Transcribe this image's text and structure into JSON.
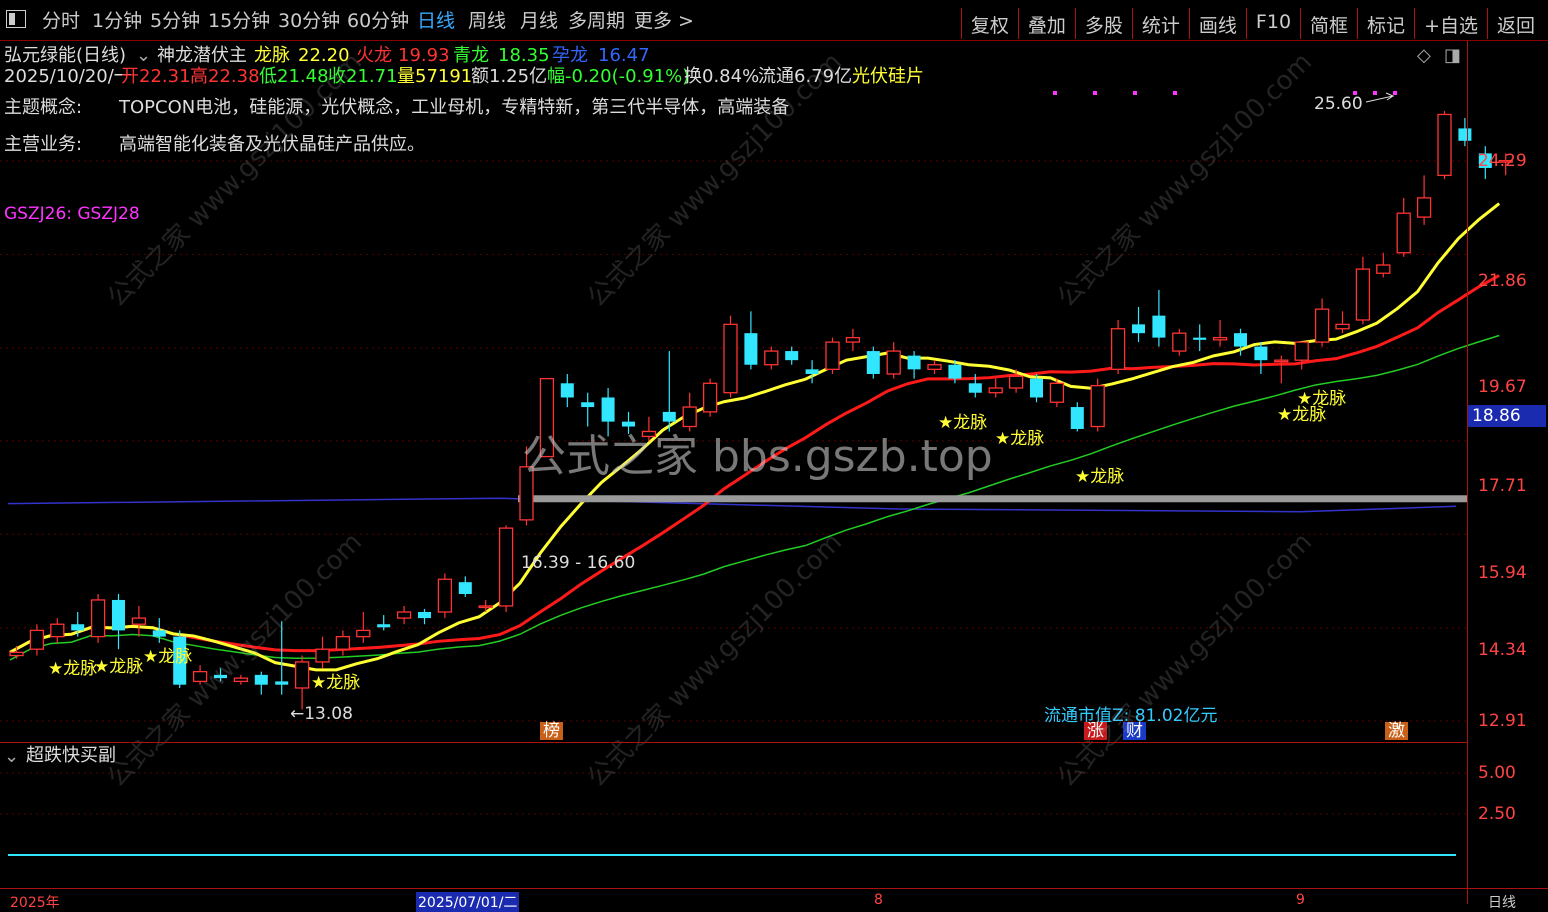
{
  "toolbar": {
    "periods": [
      "分时",
      "1分钟",
      "5分钟",
      "15分钟",
      "30分钟",
      "60分钟",
      "日线",
      "周线",
      "月线",
      "多周期",
      "更多 >"
    ],
    "selected_period": "日线",
    "right_tabs": [
      "复权",
      "叠加",
      "多股",
      "统计",
      "画线",
      "F10",
      "简框",
      "标记",
      "+自选",
      "返回"
    ]
  },
  "header": {
    "stock_name": "弘元绿能(日线)",
    "indicator_name": "神龙潜伏主",
    "longmai_label": "龙脉",
    "longmai_value": "22.20",
    "huolong_label": "火龙",
    "huolong_value": "19.93",
    "qinglong_label": "青龙",
    "qinglong_value": "18.35",
    "yunlong_label": "孕龙",
    "yunlong_value": "16.47"
  },
  "quote": {
    "date": "2025/10/20/一",
    "open": "开22.31",
    "high": "高22.38",
    "low": "低21.48",
    "close": "收21.71",
    "volume": "量57191",
    "amount": "额1.25亿",
    "change": "幅-0.20(-0.91%)",
    "turnover": "换0.84%",
    "float": "流通6.79亿",
    "sector": "光伏硅片"
  },
  "info": {
    "concept_label": "主题概念:",
    "concept_value": "TOPCON电池，硅能源，光伏概念，工业母机，专精特新，第三代半导体，高端装备",
    "business_label": "主营业务:",
    "business_value": "高端智能化装备及光伏晶硅产品供应。"
  },
  "indicator_legend": "GSZJ26: GSZJ28",
  "price_axis": [
    "24.29",
    "21.86",
    "19.67",
    "17.71",
    "15.94",
    "14.34",
    "12.91"
  ],
  "sub_axis": [
    "5.00",
    "2.50"
  ],
  "current_price_tag": "18.86",
  "sub_panel_title": "超跌快买副",
  "annotations": {
    "high_mark": "25.60",
    "low_mark": "←13.08",
    "zone_label": "16.39 - 16.60",
    "float_cap": "流通市值Z: 81.02亿元"
  },
  "signal_label": "★龙脉",
  "event_markers": [
    {
      "text": "榜",
      "color": "#c8601a"
    },
    {
      "text": "涨",
      "color": "#c81a1a"
    },
    {
      "text": "财",
      "color": "#1a3ac8"
    },
    {
      "text": "激",
      "color": "#c8601a"
    }
  ],
  "time_axis": [
    "2025年",
    "2025/07/01/二",
    "8",
    "9"
  ],
  "bottom_right": "日线",
  "watermark": "公式之家 bbs.gszb.top",
  "watermark_small": "公式之家 www.gszj100.com",
  "colors": {
    "up": "#ff3333",
    "down": "#33e6ff",
    "ma_yellow": "#ffff33",
    "ma_red": "#ff1a1a",
    "ma_green": "#22cc22",
    "ma_blue": "#3333cc",
    "axis": "#aa1111"
  },
  "chart_data": {
    "type": "candlestick",
    "y_axis_ticks": [
      24.29,
      21.86,
      19.67,
      17.71,
      15.94,
      14.34,
      12.91
    ],
    "candles": [
      {
        "o": 13.9,
        "c": 13.95,
        "h": 14.05,
        "l": 13.85
      },
      {
        "o": 14.0,
        "c": 14.3,
        "h": 14.4,
        "l": 13.9
      },
      {
        "o": 14.2,
        "c": 14.4,
        "h": 14.5,
        "l": 14.1
      },
      {
        "o": 14.4,
        "c": 14.3,
        "h": 14.6,
        "l": 14.2
      },
      {
        "o": 14.2,
        "c": 14.8,
        "h": 14.9,
        "l": 14.1
      },
      {
        "o": 14.8,
        "c": 14.3,
        "h": 14.9,
        "l": 14.0
      },
      {
        "o": 14.4,
        "c": 14.5,
        "h": 14.7,
        "l": 14.2
      },
      {
        "o": 14.3,
        "c": 14.2,
        "h": 14.5,
        "l": 14.1
      },
      {
        "o": 14.2,
        "c": 13.45,
        "h": 14.3,
        "l": 13.4
      },
      {
        "o": 13.5,
        "c": 13.65,
        "h": 13.75,
        "l": 13.45
      },
      {
        "o": 13.6,
        "c": 13.55,
        "h": 13.7,
        "l": 13.5
      },
      {
        "o": 13.5,
        "c": 13.55,
        "h": 13.6,
        "l": 13.45
      },
      {
        "o": 13.6,
        "c": 13.45,
        "h": 13.65,
        "l": 13.3
      },
      {
        "o": 13.5,
        "c": 13.45,
        "h": 14.45,
        "l": 13.3
      },
      {
        "o": 13.4,
        "c": 13.8,
        "h": 13.9,
        "l": 13.08
      },
      {
        "o": 13.8,
        "c": 14.0,
        "h": 14.2,
        "l": 13.7
      },
      {
        "o": 14.0,
        "c": 14.2,
        "h": 14.3,
        "l": 13.9
      },
      {
        "o": 14.2,
        "c": 14.3,
        "h": 14.6,
        "l": 14.1
      },
      {
        "o": 14.4,
        "c": 14.35,
        "h": 14.55,
        "l": 14.3
      },
      {
        "o": 14.5,
        "c": 14.6,
        "h": 14.7,
        "l": 14.4
      },
      {
        "o": 14.6,
        "c": 14.5,
        "h": 14.65,
        "l": 14.4
      },
      {
        "o": 14.6,
        "c": 15.15,
        "h": 15.25,
        "l": 14.5
      },
      {
        "o": 15.1,
        "c": 14.9,
        "h": 15.2,
        "l": 14.85
      },
      {
        "o": 14.7,
        "c": 14.7,
        "h": 14.8,
        "l": 14.6
      },
      {
        "o": 14.7,
        "c": 16.05,
        "h": 16.1,
        "l": 14.6
      },
      {
        "o": 16.2,
        "c": 17.2,
        "h": 17.6,
        "l": 16.1
      },
      {
        "o": 17.4,
        "c": 19.0,
        "h": 19.0,
        "l": 17.4
      },
      {
        "o": 18.9,
        "c": 18.6,
        "h": 19.1,
        "l": 18.4
      },
      {
        "o": 18.5,
        "c": 18.4,
        "h": 18.7,
        "l": 18.0
      },
      {
        "o": 18.6,
        "c": 18.1,
        "h": 18.8,
        "l": 17.8
      },
      {
        "o": 18.1,
        "c": 18.0,
        "h": 18.3,
        "l": 17.85
      },
      {
        "o": 17.8,
        "c": 17.9,
        "h": 18.2,
        "l": 17.7
      },
      {
        "o": 18.3,
        "c": 18.1,
        "h": 19.6,
        "l": 17.9
      },
      {
        "o": 18.0,
        "c": 18.4,
        "h": 18.7,
        "l": 17.9
      },
      {
        "o": 18.3,
        "c": 18.9,
        "h": 19.0,
        "l": 18.2
      },
      {
        "o": 18.7,
        "c": 20.2,
        "h": 20.4,
        "l": 18.6
      },
      {
        "o": 20.0,
        "c": 19.3,
        "h": 20.5,
        "l": 19.2
      },
      {
        "o": 19.3,
        "c": 19.6,
        "h": 19.7,
        "l": 19.2
      },
      {
        "o": 19.6,
        "c": 19.4,
        "h": 19.7,
        "l": 19.3
      },
      {
        "o": 19.2,
        "c": 19.1,
        "h": 19.4,
        "l": 18.9
      },
      {
        "o": 19.2,
        "c": 19.8,
        "h": 19.9,
        "l": 19.1
      },
      {
        "o": 19.8,
        "c": 19.9,
        "h": 20.1,
        "l": 19.6
      },
      {
        "o": 19.6,
        "c": 19.1,
        "h": 19.7,
        "l": 19.0
      },
      {
        "o": 19.1,
        "c": 19.6,
        "h": 19.8,
        "l": 19.0
      },
      {
        "o": 19.5,
        "c": 19.2,
        "h": 19.6,
        "l": 19.0
      },
      {
        "o": 19.2,
        "c": 19.3,
        "h": 19.4,
        "l": 19.1
      },
      {
        "o": 19.3,
        "c": 19.0,
        "h": 19.4,
        "l": 18.9
      },
      {
        "o": 18.9,
        "c": 18.7,
        "h": 19.1,
        "l": 18.6
      },
      {
        "o": 18.7,
        "c": 18.8,
        "h": 19.0,
        "l": 18.6
      },
      {
        "o": 18.8,
        "c": 19.05,
        "h": 19.2,
        "l": 18.7
      },
      {
        "o": 19.0,
        "c": 18.6,
        "h": 19.1,
        "l": 18.5
      },
      {
        "o": 18.5,
        "c": 18.9,
        "h": 19.0,
        "l": 18.4
      },
      {
        "o": 18.4,
        "c": 17.95,
        "h": 18.5,
        "l": 17.9
      },
      {
        "o": 18.0,
        "c": 18.85,
        "h": 19.0,
        "l": 17.9
      },
      {
        "o": 19.2,
        "c": 20.1,
        "h": 20.3,
        "l": 19.1
      },
      {
        "o": 20.2,
        "c": 20.0,
        "h": 20.6,
        "l": 19.8
      },
      {
        "o": 20.4,
        "c": 19.9,
        "h": 21.0,
        "l": 19.7
      },
      {
        "o": 19.6,
        "c": 20.0,
        "h": 20.1,
        "l": 19.5
      },
      {
        "o": 19.9,
        "c": 19.85,
        "h": 20.2,
        "l": 19.6
      },
      {
        "o": 19.85,
        "c": 19.9,
        "h": 20.3,
        "l": 19.7
      },
      {
        "o": 20.0,
        "c": 19.7,
        "h": 20.1,
        "l": 19.5
      },
      {
        "o": 19.7,
        "c": 19.4,
        "h": 19.8,
        "l": 19.1
      },
      {
        "o": 19.4,
        "c": 19.4,
        "h": 19.5,
        "l": 18.9
      },
      {
        "o": 19.4,
        "c": 19.8,
        "h": 19.8,
        "l": 19.2
      },
      {
        "o": 19.8,
        "c": 20.55,
        "h": 20.8,
        "l": 19.7
      },
      {
        "o": 20.1,
        "c": 20.2,
        "h": 20.5,
        "l": 20.0
      },
      {
        "o": 20.3,
        "c": 21.5,
        "h": 21.8,
        "l": 20.2
      },
      {
        "o": 21.4,
        "c": 21.6,
        "h": 21.9,
        "l": 21.3
      },
      {
        "o": 21.9,
        "c": 22.9,
        "h": 23.3,
        "l": 21.8
      },
      {
        "o": 22.8,
        "c": 23.3,
        "h": 23.9,
        "l": 22.6
      },
      {
        "o": 23.9,
        "c": 25.6,
        "h": 25.7,
        "l": 23.8
      },
      {
        "o": 25.2,
        "c": 24.85,
        "h": 25.5,
        "l": 24.7
      },
      {
        "o": 24.5,
        "c": 24.1,
        "h": 24.7,
        "l": 23.8
      },
      {
        "o": 24.3,
        "c": 24.3,
        "h": 24.5,
        "l": 23.9
      }
    ]
  }
}
